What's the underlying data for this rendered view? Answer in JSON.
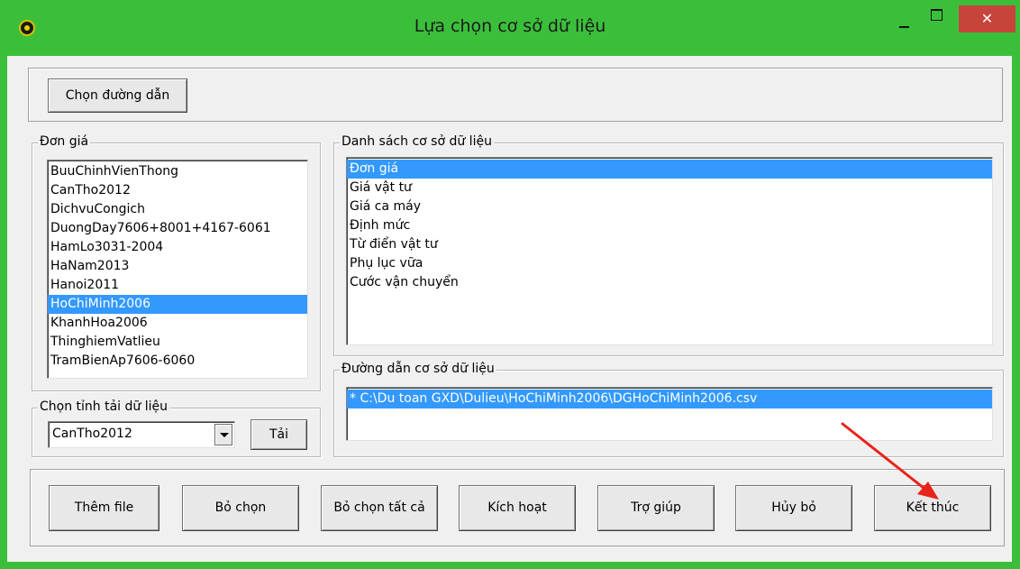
{
  "window": {
    "title": "Lựa chọn cơ sở dữ liệu",
    "close_glyph": "✕"
  },
  "toolbar": {
    "choose_path": "Chọn đường dẫn"
  },
  "don_gia": {
    "label": "Đơn giá",
    "items": [
      "BuuChinhVienThong",
      "CanTho2012",
      "DichvuCongich",
      "DuongDay7606+8001+4167-6061",
      "HamLo3031-2004",
      "HaNam2013",
      "Hanoi2011",
      "HoChiMinh2006",
      "KhanhHoa2006",
      "ThinghiemVatlieu",
      "TramBienAp7606-6060"
    ],
    "selected_index": 7
  },
  "province": {
    "label": "Chọn tỉnh tải dữ liệu",
    "selected": "CanTho2012",
    "load_button": "Tải"
  },
  "db_list": {
    "label": "Danh sách cơ sở dữ liệu",
    "items": [
      "Đơn giá",
      "Giá vật tư",
      "Giá ca máy",
      "Định mức",
      "Từ điển vật tư",
      "Phụ lục vữa",
      "Cước vận chuyển"
    ],
    "selected_index": 0
  },
  "db_path": {
    "label": "Đường dẫn cơ sở dữ liệu",
    "items": [
      "* C:\\Du toan GXD\\Dulieu\\HoChiMinh2006\\DGHoChiMinh2006.csv"
    ],
    "selected_index": 0
  },
  "actions": {
    "add_file": "Thêm file",
    "deselect": "Bỏ chọn",
    "deselect_all": "Bỏ chọn tất cả",
    "activate": "Kích hoạt",
    "help": "Trợ giúp",
    "cancel": "Hủy bỏ",
    "finish": "Kết thúc"
  },
  "colors": {
    "title_bar": "#3bbf3b",
    "selection": "#3399ff",
    "close_button": "#c7443a",
    "annotation_arrow": "#e8231a"
  },
  "icons": {
    "app": "gxd-app-icon",
    "minimize": "minimize-icon",
    "maximize": "maximize-icon",
    "close": "close-icon",
    "dropdown": "chevron-down-icon",
    "annotation": "red-arrow-annotation"
  }
}
